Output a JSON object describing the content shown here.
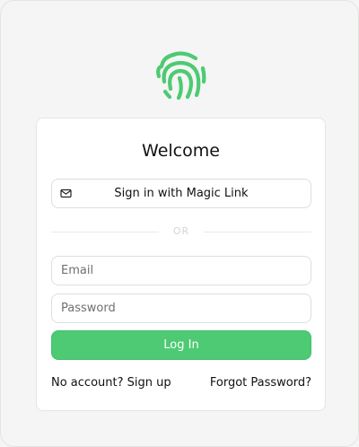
{
  "brand": {
    "logo_icon": "fingerprint-icon",
    "accent_color": "#4dca73"
  },
  "card": {
    "title": "Welcome",
    "magic_link": {
      "icon": "mail-icon",
      "label": "Sign in with Magic Link"
    },
    "divider_text": "OR",
    "email": {
      "placeholder": "Email",
      "value": ""
    },
    "password": {
      "placeholder": "Password",
      "value": ""
    },
    "login_label": "Log In",
    "signup_link": "No account? Sign up",
    "forgot_link": "Forgot Password?"
  }
}
